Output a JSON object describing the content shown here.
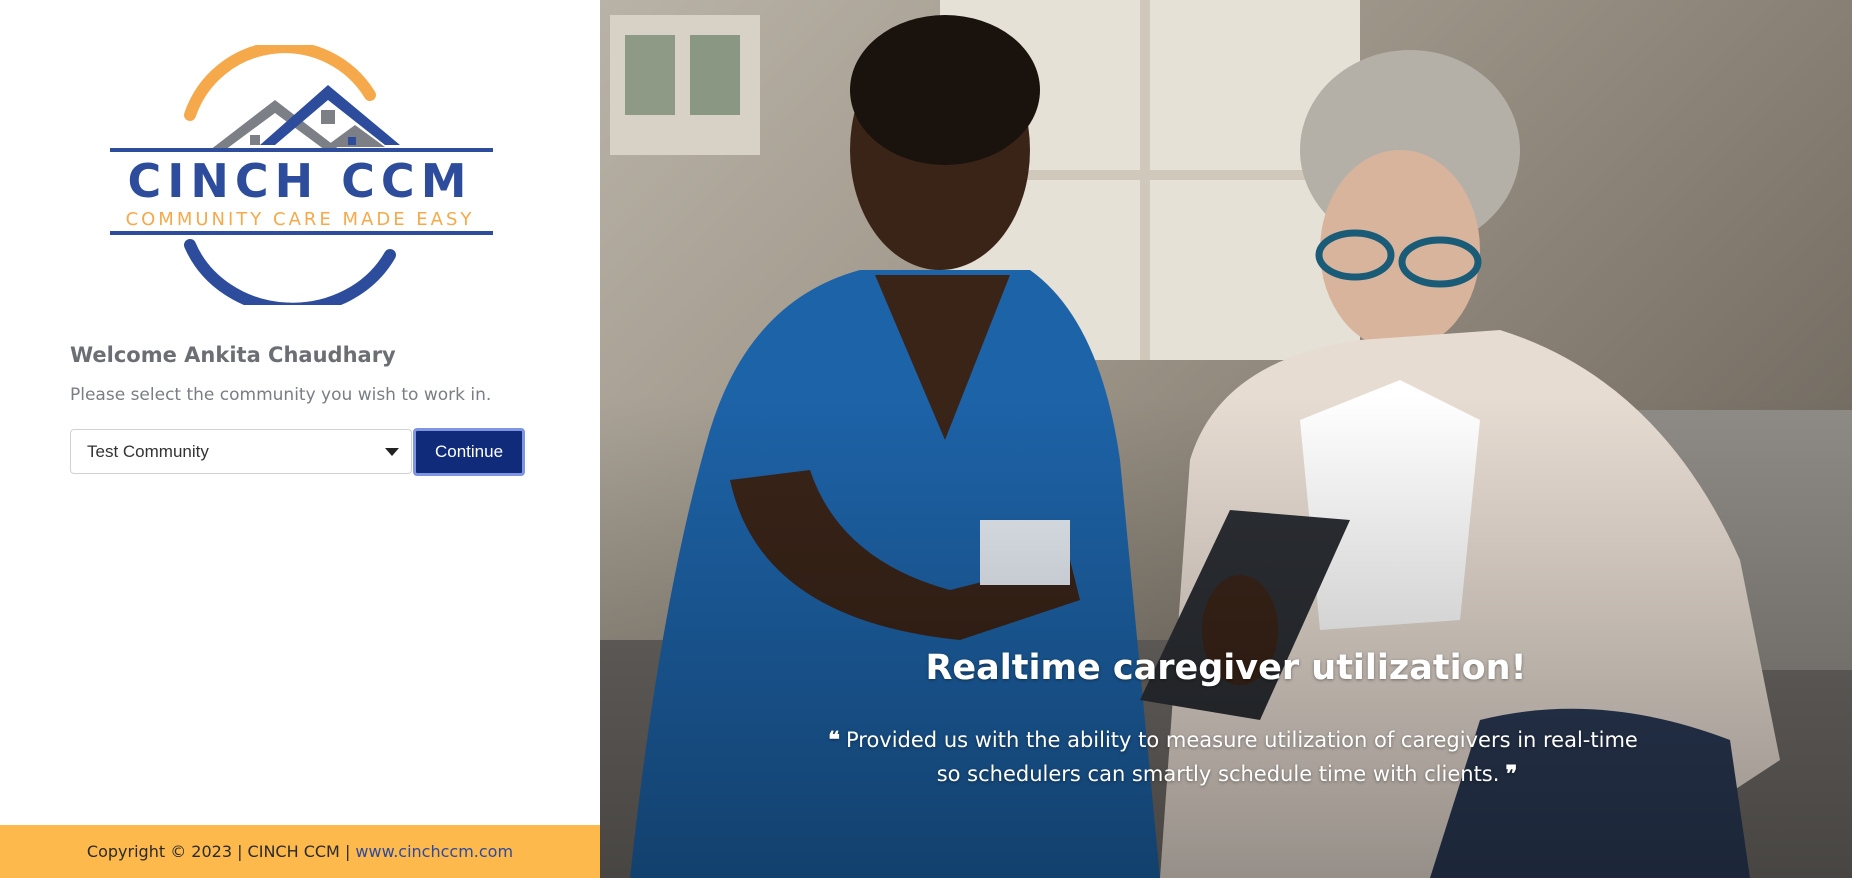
{
  "brand": {
    "name": "CINCH CCM",
    "tagline": "COMMUNITY CARE MADE EASY",
    "colors": {
      "navy": "#2d4d9c",
      "orange": "#f6a94a",
      "gray": "#7c7f86"
    }
  },
  "login": {
    "welcome": "Welcome Ankita Chaudhary",
    "instruction": "Please select the community you wish to work in.",
    "community_select": {
      "value": "Test Community"
    },
    "continue_label": "Continue"
  },
  "footer": {
    "copyright": "Copyright © 2023 | CINCH CCM | ",
    "link_text": "www.cinchccm.com"
  },
  "hero": {
    "title": "Realtime caregiver utilization!",
    "quote": "Provided us with the ability to measure utilization of caregivers in real-time so schedulers can smartly schedule time with clients.",
    "quote_open": "❝",
    "quote_close": "❞"
  }
}
